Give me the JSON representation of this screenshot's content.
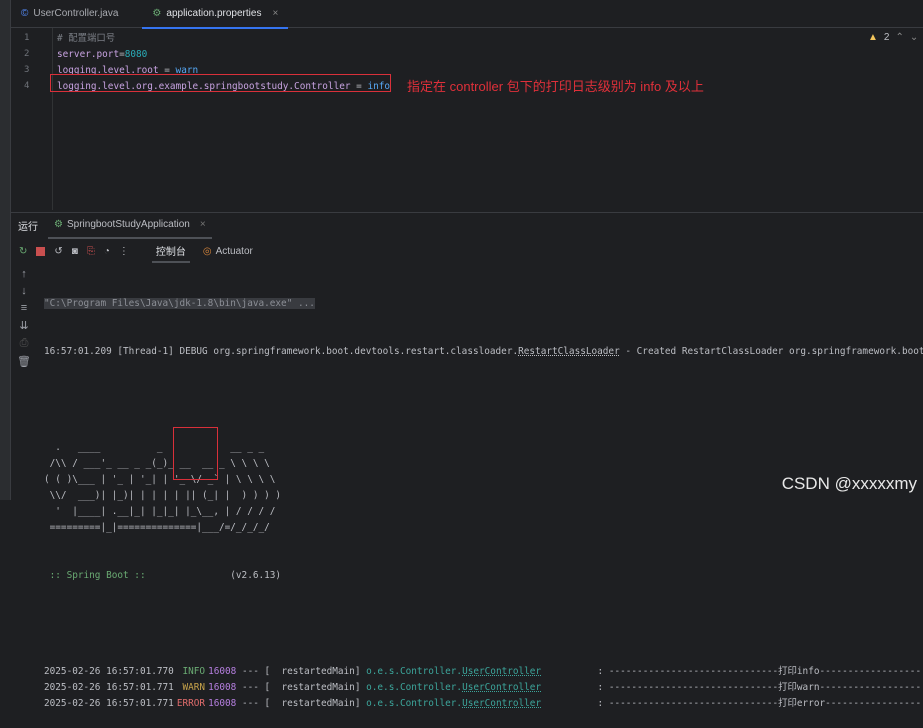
{
  "tabs": [
    {
      "label": "UserController.java",
      "icon": "class-icon"
    },
    {
      "label": "application.properties",
      "icon": "spring-properties-icon",
      "active": true
    }
  ],
  "editor": {
    "lines": [
      {
        "n": "1",
        "text": "# 配置端口号"
      },
      {
        "n": "2",
        "key": "server.port",
        "sep": "=",
        "value": "8080"
      },
      {
        "n": "3",
        "key": "logging.level.root",
        "sep": " = ",
        "value": "warn"
      },
      {
        "n": "4",
        "key": "logging.level.org.example.springbootstudy.Controller",
        "sep": " = ",
        "value": "info"
      }
    ],
    "annotation": "指定在 controller 包下的打印日志级别为 info 及以上",
    "warnings": "2"
  },
  "run": {
    "label": "运行",
    "tab": "SpringbootStudyApplication",
    "console_tab": "控制台",
    "actuator_tab": "Actuator"
  },
  "console": {
    "cmd": "\"C:\\Program Files\\Java\\jdk-1.8\\bin\\java.exe\" ...",
    "debug_pre": "16:57:01.209 [Thread-1] DEBUG org.springframework.boot.devtools.restart.classloader.",
    "debug_cls": "RestartClassLoader",
    "debug_post": " - Created RestartClassLoader org.springframework.boot.",
    "banner": [
      "  .   ____          _            __ _ _",
      " /\\\\ / ___'_ __ _ _(_)_ __  __ _ \\ \\ \\ \\",
      "( ( )\\___ | '_ | '_| | '_ \\/ _` | \\ \\ \\ \\",
      " \\\\/  ___)| |_)| | | | | || (_| |  ) ) ) )",
      "  '  |____| .__|_| |_|_| |_\\__, | / / / /",
      " =========|_|==============|___/=/_/_/_/"
    ],
    "spring_boot": " :: Spring Boot ::",
    "version": "               (v2.6.13)",
    "logs": [
      {
        "ts": "2025-02-26 16:57:01.770",
        "level": " INFO",
        "pid": "16008",
        "thread": " --- [  restartedMain] ",
        "pkg": "o.e.s.Controller.",
        "cls": "UserController",
        "msg": "          : ------------------------------打印info------------------",
        "cl": "lvl-info"
      },
      {
        "ts": "2025-02-26 16:57:01.771",
        "level": " WARN",
        "pid": "16008",
        "thread": " --- [  restartedMain] ",
        "pkg": "o.e.s.Controller.",
        "cls": "UserController",
        "msg": "          : ------------------------------打印warn------------------",
        "cl": "lvl-warn"
      },
      {
        "ts": "2025-02-26 16:57:01.771",
        "level": "ERROR",
        "pid": "16008",
        "thread": " --- [  restartedMain] ",
        "pkg": "o.e.s.Controller.",
        "cls": "UserController",
        "msg": "          : ------------------------------打印error-----------------",
        "cl": "lvl-error"
      }
    ]
  },
  "watermark": "CSDN @xxxxxmy"
}
